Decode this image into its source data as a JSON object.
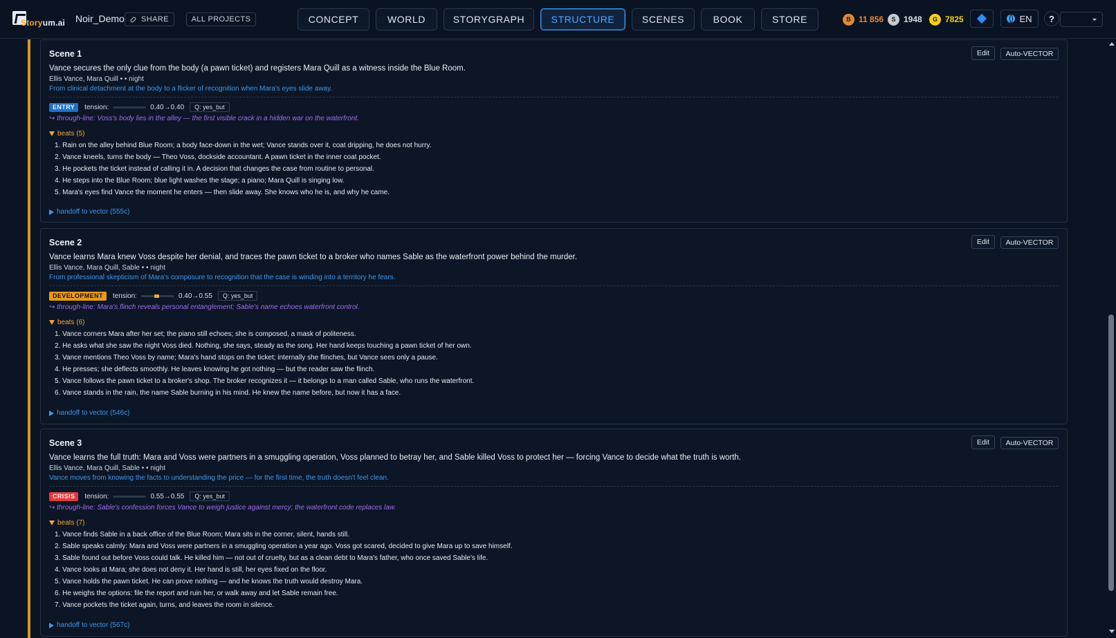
{
  "header": {
    "logo_text_a": "Story",
    "logo_text_b": "um.ai",
    "project_name": "Noir_Demo",
    "share_label": "SHARE",
    "all_projects_label": "ALL PROJECTS",
    "tabs": [
      {
        "label": "CONCEPT",
        "active": false
      },
      {
        "label": "WORLD",
        "active": false
      },
      {
        "label": "STORYGRAPH",
        "active": false
      },
      {
        "label": "STRUCTURE",
        "active": true
      },
      {
        "label": "SCENES",
        "active": false
      },
      {
        "label": "BOOK",
        "active": false
      },
      {
        "label": "STORE",
        "active": false
      }
    ],
    "currencies": {
      "bronze": {
        "icon": "B",
        "value": "11 856",
        "color": "#e6893a"
      },
      "silver": {
        "icon": "S",
        "value": "1948",
        "color": "#d8dee6"
      },
      "gold": {
        "icon": "G",
        "value": "7825",
        "color": "#f4cf18"
      }
    },
    "language": "EN",
    "help_label": "?"
  },
  "scenes": [
    {
      "title": "Scene 1",
      "edit_label": "Edit",
      "auto_label": "Auto-VECTOR",
      "summary": "Vance secures the only clue from the body (a pawn ticket) and registers Mara Quill as a witness inside the Blue Room.",
      "characters": "Ellis Vance, Mara Quill • • night",
      "arc": "From clinical detachment at the body to a flicker of recognition when Mara's eyes slide away.",
      "stage": "ENTRY",
      "tension_label": "tension:",
      "tension_from": 0.4,
      "tension_to": 0.4,
      "tension_text": "0.40→0.40",
      "question": "Q: yes_but",
      "through_line": "↪ through-line: Voss's body lies in the alley — the first visible crack in a hidden war on the waterfront.",
      "beats_label": "beats (5)",
      "beats": [
        "1. Rain on the alley behind Blue Room; a body face-down in the wet; Vance stands over it, coat dripping, he does not hurry.",
        "2. Vance kneels, turns the body — Theo Voss, dockside accountant. A pawn ticket in the inner coat pocket.",
        "3. He pockets the ticket instead of calling it in. A decision that changes the case from routine to personal.",
        "4. He steps into the Blue Room; blue light washes the stage; a piano; Mara Quill is singing low.",
        "5. Mara's eyes find Vance the moment he enters — then slide away. She knows who he is, and why he came."
      ],
      "handoff": "handoff to vector (555c)"
    },
    {
      "title": "Scene 2",
      "edit_label": "Edit",
      "auto_label": "Auto-VECTOR",
      "summary": "Vance learns Mara knew Voss despite her denial, and traces the pawn ticket to a broker who names Sable as the waterfront power behind the murder.",
      "characters": "Ellis Vance, Mara Quill, Sable • • night",
      "arc": "From professional skepticism of Mara's composure to recognition that the case is winding into a territory he fears.",
      "stage": "DEVELOPMENT",
      "tension_label": "tension:",
      "tension_from": 0.4,
      "tension_to": 0.55,
      "tension_text": "0.40→0.55",
      "question": "Q: yes_but",
      "through_line": "↪ through-line: Mara's flinch reveals personal entanglement; Sable's name echoes waterfront control.",
      "beats_label": "beats (6)",
      "beats": [
        "1. Vance corners Mara after her set; the piano still echoes; she is composed, a mask of politeness.",
        "2. He asks what she saw the night Voss died. Nothing, she says, steady as the song. Her hand keeps touching a pawn ticket of her own.",
        "3. Vance mentions Theo Voss by name; Mara's hand stops on the ticket; internally she flinches, but Vance sees only a pause.",
        "4. He presses; she deflects smoothly. He leaves knowing he got nothing — but the reader saw the flinch.",
        "5. Vance follows the pawn ticket to a broker's shop. The broker recognizes it — it belongs to a man called Sable, who runs the waterfront.",
        "6. Vance stands in the rain, the name Sable burning in his mind. He knew the name before, but now it has a face."
      ],
      "handoff": "handoff to vector (546c)"
    },
    {
      "title": "Scene 3",
      "edit_label": "Edit",
      "auto_label": "Auto-VECTOR",
      "summary": "Vance learns the full truth: Mara and Voss were partners in a smuggling operation, Voss planned to betray her, and Sable killed Voss to protect her — forcing Vance to decide what the truth is worth.",
      "characters": "Ellis Vance, Mara Quill, Sable • • night",
      "arc": "Vance moves from knowing the facts to understanding the price — for the first time, the truth doesn't feel clean.",
      "stage": "CRISIS",
      "tension_label": "tension:",
      "tension_from": 0.55,
      "tension_to": 0.55,
      "tension_text": "0.55→0.55",
      "question": "Q: yes_but",
      "through_line": "↪ through-line: Sable's confession forces Vance to weigh justice against mercy; the waterfront code replaces law.",
      "beats_label": "beats (7)",
      "beats": [
        "1. Vance finds Sable in a back office of the Blue Room; Mara sits in the corner, silent, hands still.",
        "2. Sable speaks calmly: Mara and Voss were partners in a smuggling operation a year ago. Voss got scared, decided to give Mara up to save himself.",
        "3. Sable found out before Voss could talk. He killed him — not out of cruelty, but as a clean debt to Mara's father, who once saved Sable's life.",
        "4. Vance looks at Mara; she does not deny it. Her hand is still, her eyes fixed on the floor.",
        "5. Vance holds the pawn ticket. He can prove nothing — and he knows the truth would destroy Mara.",
        "6. He weighs the options: file the report and ruin her, or walk away and let Sable remain free.",
        "7. Vance pockets the ticket again, turns, and leaves the room in silence."
      ],
      "handoff": "handoff to vector (567c)"
    }
  ]
}
